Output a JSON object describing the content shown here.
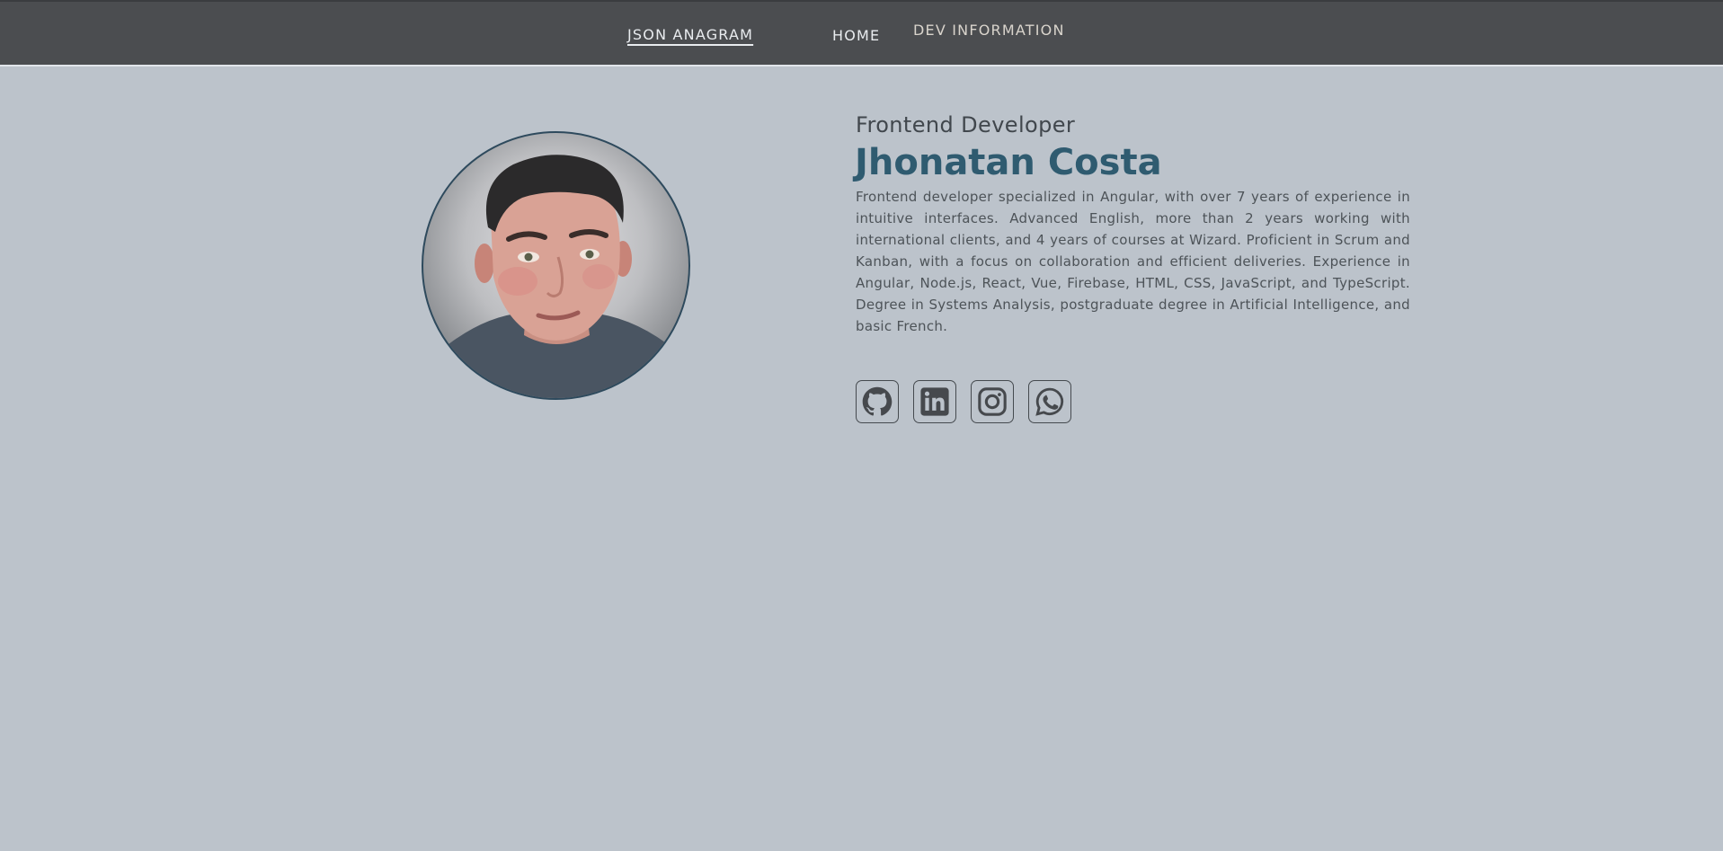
{
  "nav": {
    "brand": "JSON ANAGRAM",
    "home": "HOME",
    "dev_information": "DEV INFORMATION"
  },
  "profile": {
    "role": "Frontend Developer",
    "name": "Jhonatan Costa",
    "bio": "Frontend developer specialized in Angular, with over 7 years of experience in intuitive interfaces. Advanced English, more than 2 years working with international clients, and 4 years of courses at Wizard. Proficient in Scrum and Kanban, with a focus on collaboration and efficient deliveries. Experience in Angular, Node.js, React, Vue, Firebase, HTML, CSS, JavaScript, and TypeScript. Degree in Systems Analysis, postgraduate degree in Artificial Intelligence, and basic French."
  },
  "socials": [
    {
      "icon": "github-icon"
    },
    {
      "icon": "linkedin-icon"
    },
    {
      "icon": "instagram-icon"
    },
    {
      "icon": "whatsapp-icon"
    }
  ],
  "colors": {
    "background": "#bcc3cb",
    "navbar": "#4b4d50",
    "name_accent": "#2f5b70",
    "icon": "#46494d"
  }
}
